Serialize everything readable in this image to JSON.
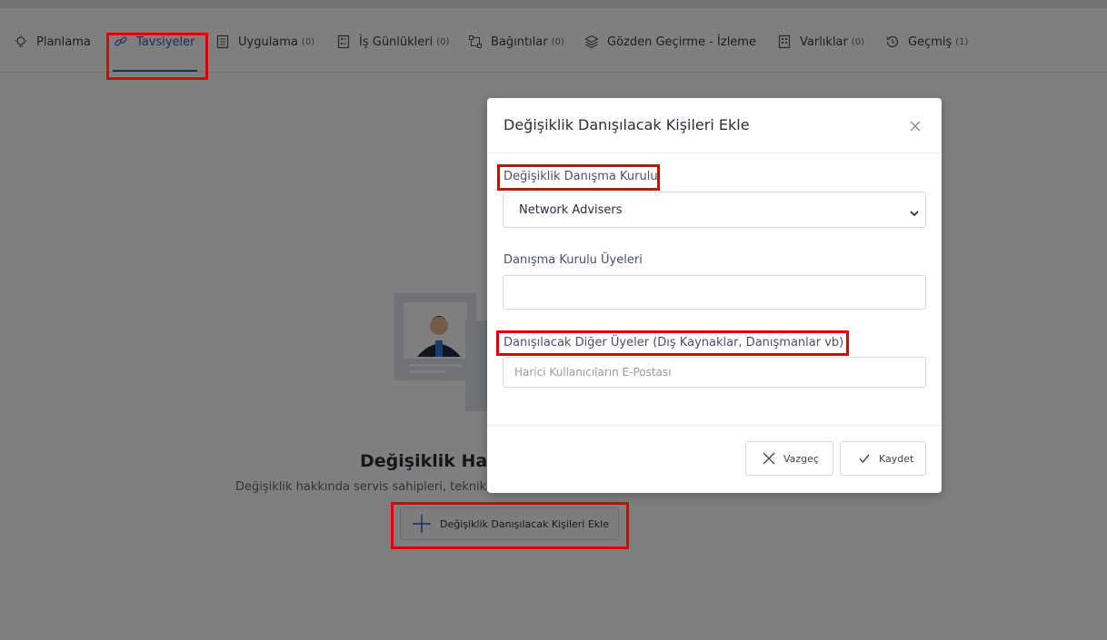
{
  "tabs": [
    {
      "label": "Planlama",
      "count": "",
      "icon": "bulb-icon"
    },
    {
      "label": "Tavsiyeler",
      "count": "",
      "icon": "link-icon",
      "active": true
    },
    {
      "label": "Uygulama",
      "count": "(0)",
      "icon": "clipboard-icon"
    },
    {
      "label": "İş Günlükleri",
      "count": "(0)",
      "icon": "worklog-icon"
    },
    {
      "label": "Bağıntılar",
      "count": "(0)",
      "icon": "relation-icon"
    },
    {
      "label": "Gözden Geçirme - İzleme",
      "count": "",
      "icon": "layers-icon"
    },
    {
      "label": "Varlıklar",
      "count": "(0)",
      "icon": "asset-icon"
    },
    {
      "label": "Geçmiş",
      "count": "(1)",
      "icon": "history-icon"
    }
  ],
  "empty_state": {
    "title": "Değişiklik Hakk",
    "description": "Değişiklik hakkında servis sahipleri, teknik uz",
    "add_button": "Değişiklik Danışılacak Kişileri Ekle"
  },
  "modal": {
    "title": "Değişiklik Danışılacak Kişileri Ekle",
    "board_label": "Değişiklik Danışma Kurulu",
    "board_value": "Network Advisers",
    "members_label": "Danışma Kurulu Üyeleri",
    "members_value": "",
    "others_label": "Danışılacak Diğer Üyeler (Dış Kaynaklar, Danışmanlar vb)",
    "others_placeholder": "Harici Kullanıcıların E-Postası",
    "cancel_label": "Vazgeç",
    "save_label": "Kaydet"
  },
  "colors": {
    "accent": "#2f5fb8",
    "highlight": "#e00000",
    "overlay": "rgba(0,0,0,0.5)"
  }
}
